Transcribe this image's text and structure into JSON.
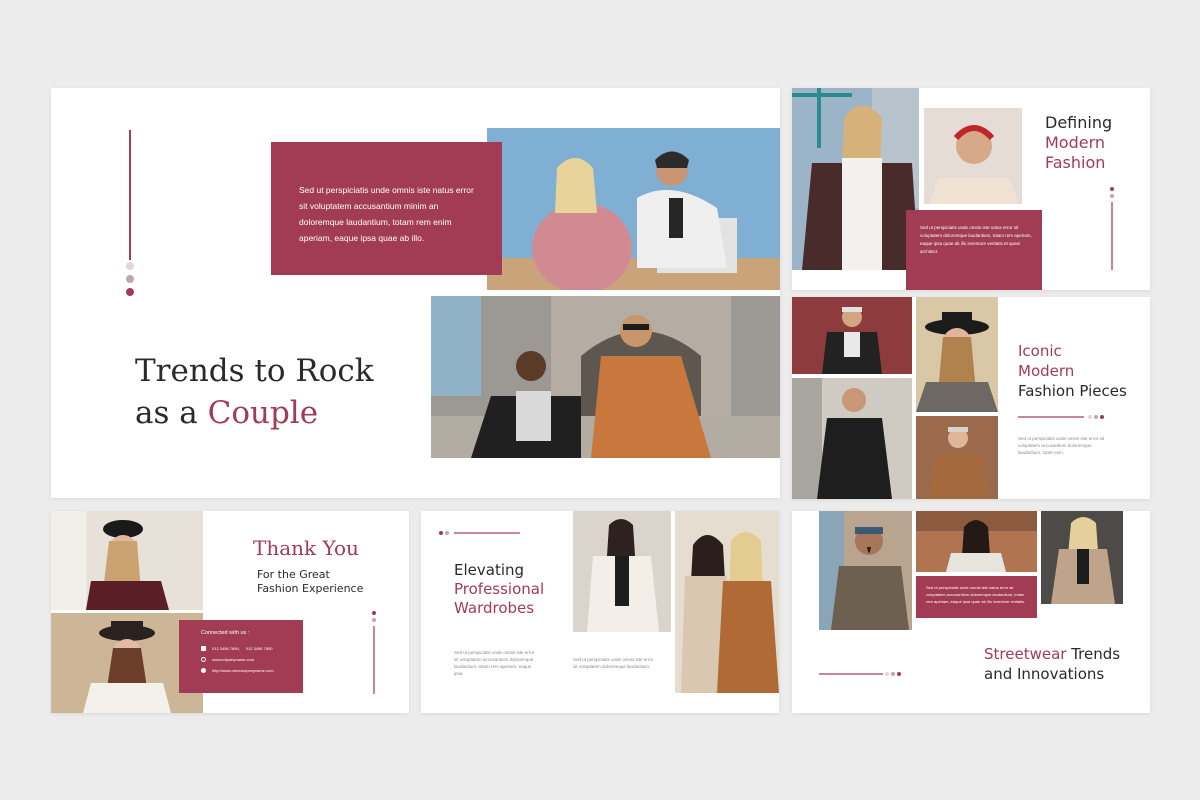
{
  "colors": {
    "accent": "#a23c55",
    "dark": "#2a2a2a",
    "background": "#ececec"
  },
  "slide_main": {
    "title_line1": "Trends to Rock",
    "title_line2_prefix": "as a ",
    "title_line2_accent": "Couple",
    "box_text": "Sed ut perspiciatis unde omnis iste natus error sit voluptatem accusantium minim an doloremque laudantium, totam rem  enim aperiam, eaque ipsa quae ab illo."
  },
  "slide_defining": {
    "title_line1": "Defining",
    "title_line2": "Modern",
    "title_line3": "Fashion",
    "box_text": "Sed ut perspiciatis unde omnis iste natus error sit voluptatem doloremque laudantium, totam rem aperiam, eaque ipsa quae ab illo inventore veritatis et quasi architect."
  },
  "slide_iconic": {
    "title_line1": "Iconic",
    "title_line2": "Modern",
    "title_line3": "Fashion Pieces",
    "body_text": "Sed ut perspiciatis unde omnis iste error sit voluptatem accusantium doloremque laudantium, totam rem."
  },
  "slide_thanks": {
    "title": "Thank You",
    "subtitle_line1": "For the Great",
    "subtitle_line2": "Fashion Experience",
    "connected_label": "Connected with us :",
    "phone_1": "012 3456 7890,",
    "phone_2": "012 3456 7890",
    "email": "niceconipanyname.com",
    "website": "http://www.niceconipanyname.com"
  },
  "slide_wardrobes": {
    "title_line1": "Elevating",
    "title_line2": "Professional",
    "title_line3": "Wardrobes",
    "body_left": "Sed ut perspiciatis unde omnis iste error sit voluptatem accusantium doloremque laudantium, totam rem aperiam, eaque ipsa.",
    "body_right": "Sed ut perspiciatis unde omnis iste error sit voluptatem doloremque laudantium."
  },
  "slide_streetwear": {
    "title_accent": "Streetwear",
    "title_rest": " Trends",
    "title_line2": "and Innovations",
    "box_text": "Sed ut perspiciatis unde omnis iste natus error sit voluptatem accusantium doloremque laudantium, totam rem aperiam, eaque ipsa quae ab illo inventore veritatis."
  }
}
